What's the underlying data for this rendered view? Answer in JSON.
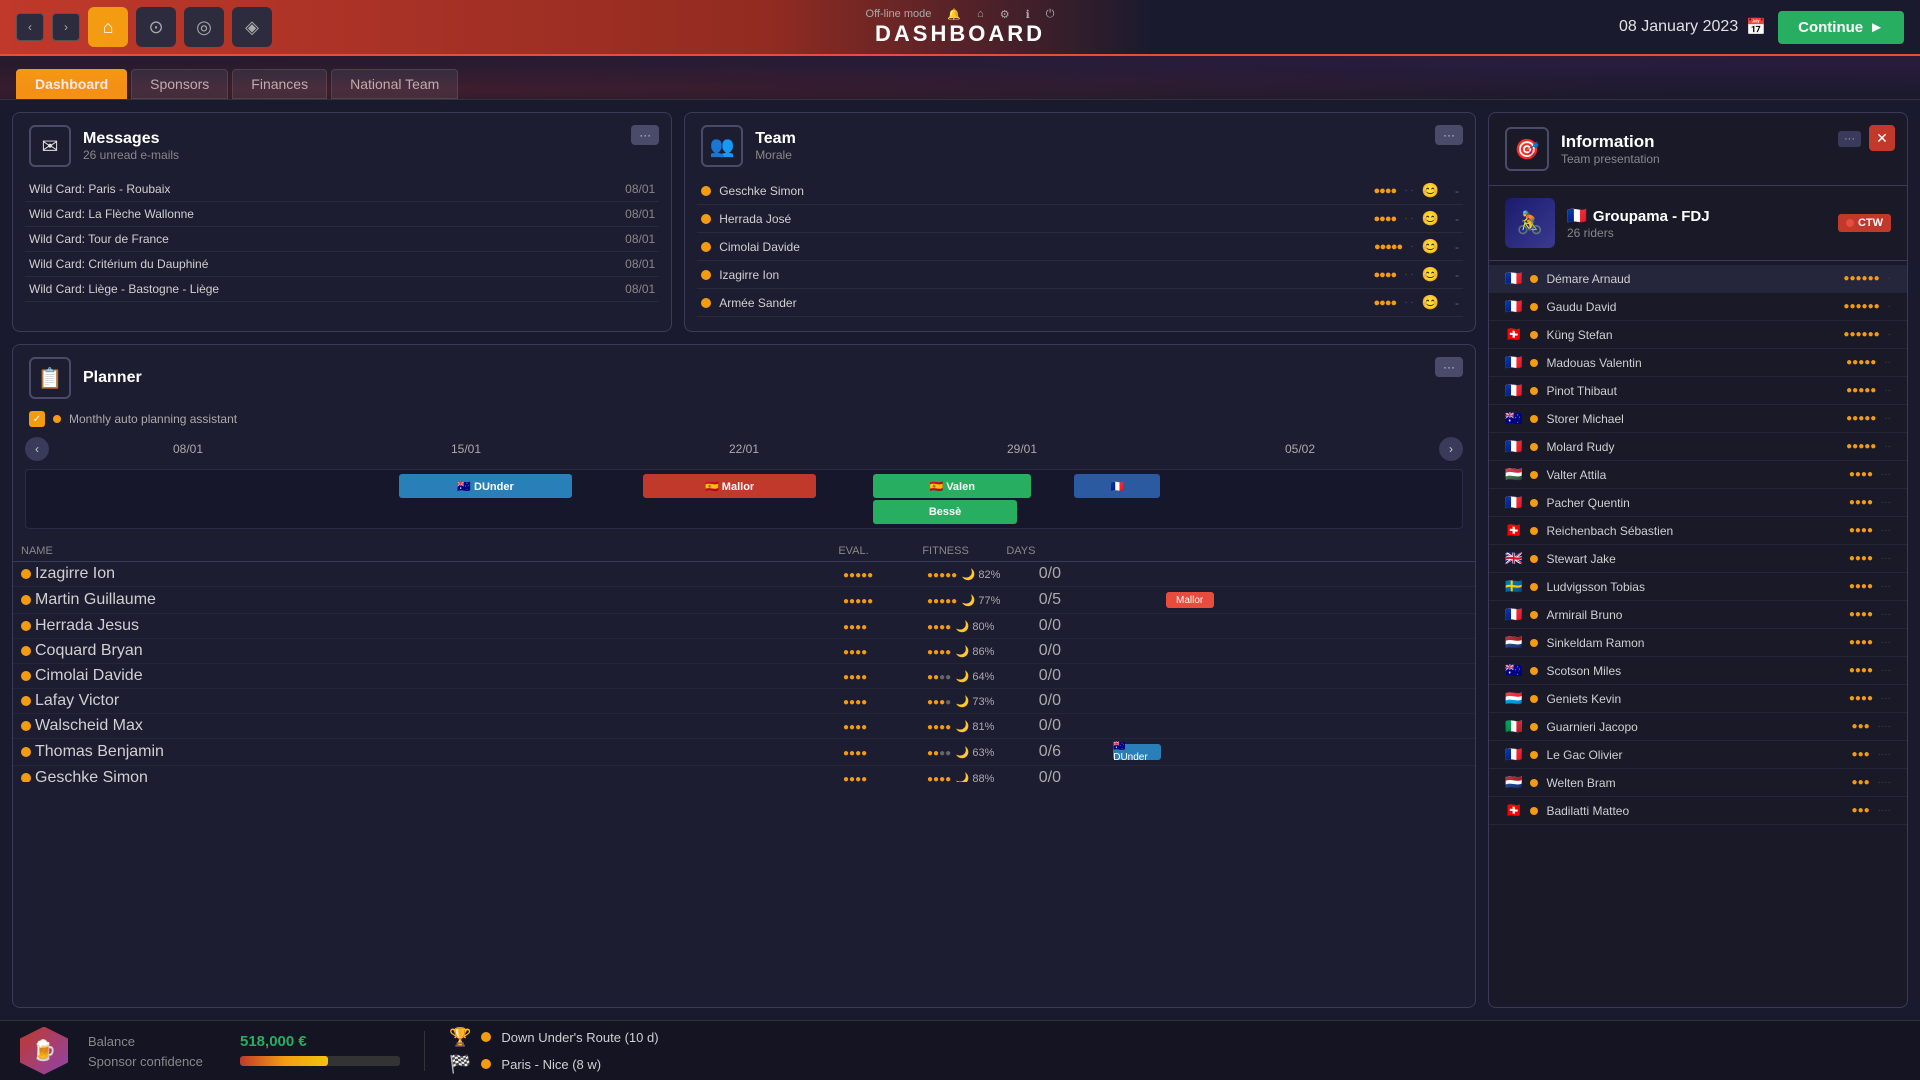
{
  "topBar": {
    "mode": "Off-line mode",
    "title": "DASHBOARD",
    "date": "08 January 2023",
    "continueLabel": "Continue"
  },
  "tabs": [
    {
      "id": "dashboard",
      "label": "Dashboard",
      "active": true
    },
    {
      "id": "sponsors",
      "label": "Sponsors",
      "active": false
    },
    {
      "id": "finances",
      "label": "Finances",
      "active": false
    },
    {
      "id": "national-team",
      "label": "National Team",
      "active": false
    }
  ],
  "messages": {
    "title": "Messages",
    "subtitle": "26 unread e-mails",
    "items": [
      {
        "name": "Wild Card: Paris - Roubaix",
        "date": "08/01"
      },
      {
        "name": "Wild Card: La Flèche Wallonne",
        "date": "08/01"
      },
      {
        "name": "Wild Card: Tour de France",
        "date": "08/01"
      },
      {
        "name": "Wild Card: Critérium du Dauphiné",
        "date": "08/01"
      },
      {
        "name": "Wild Card: Liège - Bastogne - Liège",
        "date": "08/01"
      }
    ]
  },
  "team": {
    "title": "Team",
    "subtitle": "Morale",
    "riders": [
      {
        "name": "Geschke Simon",
        "stars": 4,
        "maxStars": 6,
        "mood": "😊",
        "extra": "-"
      },
      {
        "name": "Herrada José",
        "stars": 4,
        "maxStars": 6,
        "mood": "😊",
        "extra": "-"
      },
      {
        "name": "Cimolai Davide",
        "stars": 5,
        "maxStars": 6,
        "mood": "😊",
        "extra": "-"
      },
      {
        "name": "Izagirre Ion",
        "stars": 4,
        "maxStars": 6,
        "mood": "😊",
        "extra": "-"
      },
      {
        "name": "Armée Sander",
        "stars": 4,
        "maxStars": 6,
        "mood": "😊",
        "extra": "-"
      }
    ]
  },
  "planner": {
    "title": "Planner",
    "autoPlanning": "Monthly auto planning assistant",
    "dates": [
      "08/01",
      "15/01",
      "22/01",
      "29/01",
      "05/02"
    ],
    "riderRows": [
      {
        "name": "Izagirre Ion",
        "evalStars": 5,
        "fitness": "82%",
        "days": "0/0"
      },
      {
        "name": "Martin Guillaume",
        "evalStars": 5,
        "fitness": "77%",
        "days": "0/5"
      },
      {
        "name": "Herrada Jesus",
        "evalStars": 4,
        "fitness": "80%",
        "days": "0/0"
      },
      {
        "name": "Coquard Bryan",
        "evalStars": 4,
        "fitness": "86%",
        "days": "0/0"
      },
      {
        "name": "Cimolai Davide",
        "evalStars": 4,
        "fitness": "64%",
        "days": "0/0"
      },
      {
        "name": "Lafay Victor",
        "evalStars": 4,
        "fitness": "73%",
        "days": "0/0"
      },
      {
        "name": "Walscheid Max",
        "evalStars": 4,
        "fitness": "81%",
        "days": "0/0"
      },
      {
        "name": "Thomas Benjamin",
        "evalStars": 4,
        "fitness": "63%",
        "days": "0/6"
      },
      {
        "name": "Geschke Simon",
        "evalStars": 4,
        "fitness": "88%",
        "days": "0/0"
      }
    ],
    "tableHeaders": {
      "name": "NAME",
      "eval": "EVAL.",
      "fitness": "FITNESS",
      "days": "DAYS"
    }
  },
  "information": {
    "title": "Information",
    "subtitle": "Team presentation",
    "team": {
      "name": "Groupama - FDJ",
      "riders": "26 riders",
      "badge": "CTW"
    },
    "riders": [
      {
        "name": "Démare Arnaud",
        "flag": "🇫🇷",
        "dot": "#f39c12",
        "stars": 6,
        "maxStars": 7
      },
      {
        "name": "Gaudu David",
        "flag": "🇫🇷",
        "dot": "#f39c12",
        "stars": 6,
        "maxStars": 7
      },
      {
        "name": "Küng Stefan",
        "flag": "🇨🇭",
        "dot": "#f39c12",
        "stars": 6,
        "maxStars": 7
      },
      {
        "name": "Madouas Valentin",
        "flag": "🇫🇷",
        "dot": "#f39c12",
        "stars": 5,
        "maxStars": 7
      },
      {
        "name": "Pinot Thibaut",
        "flag": "🇫🇷",
        "dot": "#f39c12",
        "stars": 5,
        "maxStars": 7
      },
      {
        "name": "Storer Michael",
        "flag": "🇦🇺",
        "dot": "#f39c12",
        "stars": 5,
        "maxStars": 7
      },
      {
        "name": "Molard Rudy",
        "flag": "🇫🇷",
        "dot": "#f39c12",
        "stars": 5,
        "maxStars": 7
      },
      {
        "name": "Valter Attila",
        "flag": "🇭🇺",
        "dot": "#f39c12",
        "stars": 4,
        "maxStars": 7
      },
      {
        "name": "Pacher Quentin",
        "flag": "🇫🇷",
        "dot": "#f39c12",
        "stars": 4,
        "maxStars": 7
      },
      {
        "name": "Reichenbach Sébastien",
        "flag": "🇨🇭",
        "dot": "#f39c12",
        "stars": 4,
        "maxStars": 7
      },
      {
        "name": "Stewart Jake",
        "flag": "🇬🇧",
        "dot": "#f39c12",
        "stars": 4,
        "maxStars": 7
      },
      {
        "name": "Ludvigsson Tobias",
        "flag": "🇸🇪",
        "dot": "#f39c12",
        "stars": 4,
        "maxStars": 7
      },
      {
        "name": "Armirail Bruno",
        "flag": "🇫🇷",
        "dot": "#f39c12",
        "stars": 4,
        "maxStars": 7
      },
      {
        "name": "Sinkeldam Ramon",
        "flag": "🇳🇱",
        "dot": "#f39c12",
        "stars": 4,
        "maxStars": 7
      },
      {
        "name": "Scotson Miles",
        "flag": "🇦🇺",
        "dot": "#f39c12",
        "stars": 4,
        "maxStars": 7
      },
      {
        "name": "Geniets Kevin",
        "flag": "🇱🇺",
        "dot": "#f39c12",
        "stars": 4,
        "maxStars": 7
      },
      {
        "name": "Guarnieri Jacopo",
        "flag": "🇮🇹",
        "dot": "#f39c12",
        "stars": 3,
        "maxStars": 7
      },
      {
        "name": "Le Gac Olivier",
        "flag": "🇫🇷",
        "dot": "#f39c12",
        "stars": 3,
        "maxStars": 7
      },
      {
        "name": "Welten Bram",
        "flag": "🇳🇱",
        "dot": "#f39c12",
        "stars": 3,
        "maxStars": 7
      },
      {
        "name": "Badilatti Matteo",
        "flag": "🇨🇭",
        "dot": "#f39c12",
        "stars": 3,
        "maxStars": 7
      }
    ]
  },
  "bottomBar": {
    "balance": {
      "label": "Balance",
      "value": "518,000 €"
    },
    "sponsorConfidence": {
      "label": "Sponsor confidence",
      "percent": 55
    },
    "events": [
      {
        "icon": "🏆",
        "name": "Down Under's Route (10 d)"
      },
      {
        "icon": "🏁",
        "name": "Paris - Nice (8 w)"
      }
    ]
  }
}
